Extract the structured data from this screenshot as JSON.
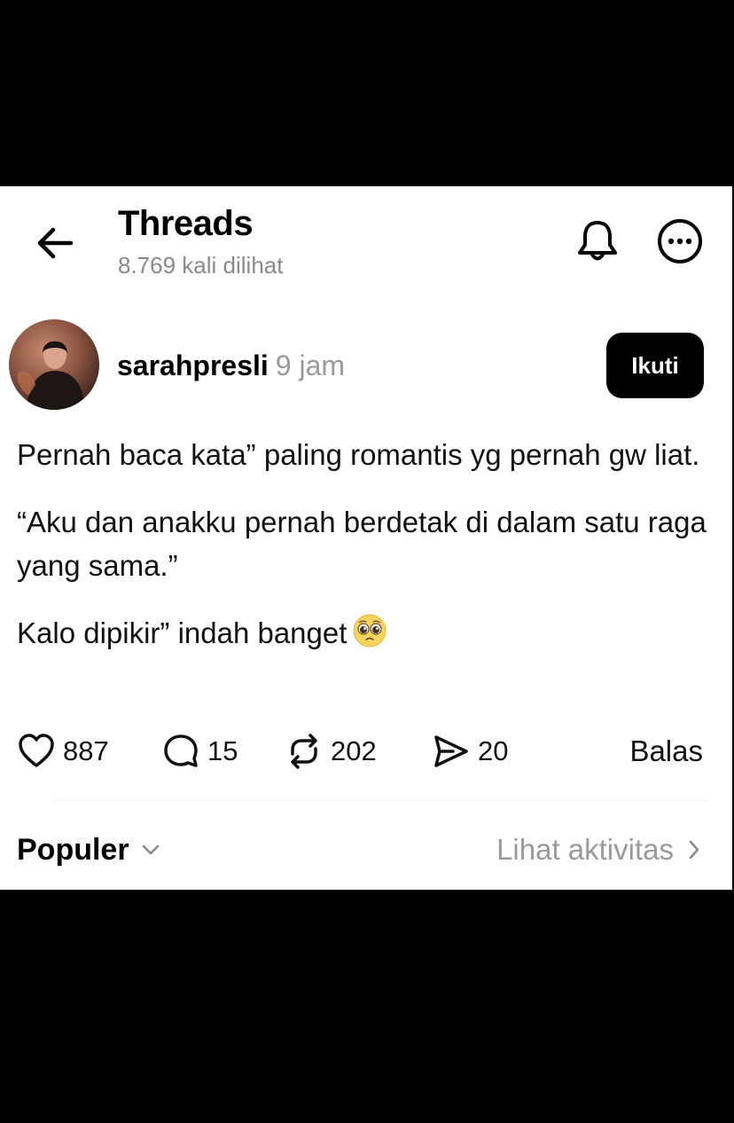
{
  "header": {
    "title": "Threads",
    "views": "8.769 kali dilihat"
  },
  "author": {
    "username": "sarahpresli",
    "time": "9 jam",
    "follow_label": "Ikuti"
  },
  "post": {
    "paragraphs": [
      "Pernah baca kata” paling romantis yg pernah gw liat.",
      "“Aku dan anakku pernah berdetak di dalam satu raga yang sama.”",
      "Kalo dipikir” indah banget"
    ],
    "emoji": "pleading-face-emoji"
  },
  "actions": {
    "likes": "887",
    "comments": "15",
    "reposts": "202",
    "shares": "20",
    "reply_label": "Balas"
  },
  "footer": {
    "sort_label": "Populer",
    "activity_label": "Lihat aktivitas"
  },
  "icons": {
    "back": "arrow-left-icon",
    "bell": "bell-icon",
    "more": "more-icon",
    "like": "heart-icon",
    "comment": "comment-icon",
    "repost": "repost-icon",
    "share": "send-icon",
    "sort": "chevron-down-icon",
    "activity": "chevron-right-icon"
  }
}
